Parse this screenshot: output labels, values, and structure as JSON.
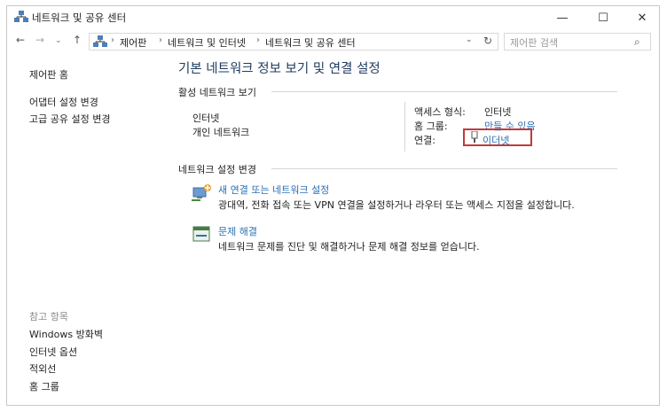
{
  "window": {
    "title": "네트워크 및 공유 센터",
    "minimize": "—",
    "maximize": "☐",
    "close": "✕"
  },
  "address": {
    "back": "←",
    "forward": "→",
    "history": "⌄",
    "up": "↑",
    "crumbs": [
      "제어판",
      "네트워크 및 인터넷",
      "네트워크 및 공유 센터"
    ],
    "separator": "›",
    "dropdown": "⌄",
    "refresh": "↻",
    "search_placeholder": "제어판 검색",
    "search_icon": "⌕"
  },
  "sidebar": {
    "home": "제어판 홈",
    "links": [
      "어댑터 설정 변경",
      "고급 공유 설정 변경"
    ],
    "see_also_title": "참고 항목",
    "see_also": [
      "Windows 방화벽",
      "인터넷 옵션",
      "적외선",
      "홈 그룹"
    ]
  },
  "main": {
    "title": "기본 네트워크 정보 보기 및 연결 설정",
    "active_section": "활성 네트워크 보기",
    "network_name": "인터넷",
    "network_type": "개인 네트워크",
    "access_label": "액세스 형식:",
    "access_value": "인터넷",
    "homegroup_label": "홈 그룹:",
    "homegroup_value": "만들 수 있음",
    "connection_label": "연결:",
    "connection_value": "이더넷",
    "change_section": "네트워크 설정 변경",
    "tasks": [
      {
        "title": "새 연결 또는 네트워크 설정",
        "desc": "광대역, 전화 접속 또는 VPN 연결을 설정하거나 라우터 또는 액세스 지점을 설정합니다."
      },
      {
        "title": "문제 해결",
        "desc": "네트워크 문제를 진단 및 해결하거나 문제 해결 정보를 얻습니다."
      }
    ]
  },
  "colors": {
    "link": "#2a6fb5",
    "highlight": "#c0393b",
    "title": "#1e3a5f"
  },
  "icons": [
    "network-center-icon",
    "ethernet-icon",
    "new-connection-icon",
    "troubleshoot-icon",
    "search-icon"
  ]
}
